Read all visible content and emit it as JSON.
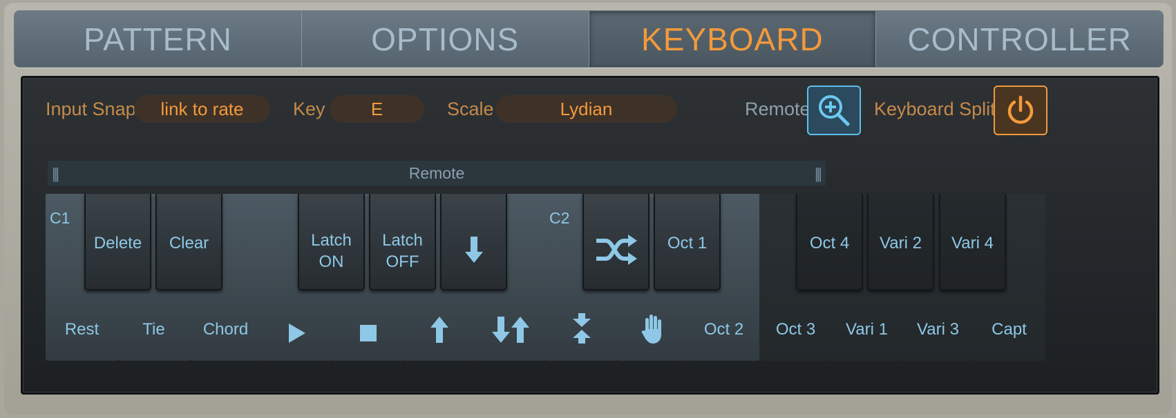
{
  "tabs": [
    {
      "label": "PATTERN"
    },
    {
      "label": "OPTIONS"
    },
    {
      "label": "KEYBOARD"
    },
    {
      "label": "CONTROLLER"
    }
  ],
  "active_tab": "KEYBOARD",
  "controls": {
    "input_snap_label": "Input Snap",
    "input_snap_value": "link to rate",
    "key_label": "Key",
    "key_value": "E",
    "scale_label": "Scale",
    "scale_value": "Lydian",
    "remote_label": "Remote",
    "keyboard_split_label": "Keyboard Split"
  },
  "remote_bar": {
    "label": "Remote"
  },
  "notes": {
    "c1": "C1",
    "c2": "C2"
  },
  "white_keys": [
    {
      "label": "Rest"
    },
    {
      "label": "Tie"
    },
    {
      "label": "Chord"
    },
    {
      "icon": "play-icon"
    },
    {
      "icon": "stop-icon"
    },
    {
      "icon": "arrow-up-icon"
    },
    {
      "icon": "arrows-down-up-icon"
    },
    {
      "icon": "arrows-converge-icon"
    },
    {
      "icon": "hand-icon"
    },
    {
      "label": "Oct 2"
    },
    {
      "label": "Oct 3"
    },
    {
      "label": "Vari 1"
    },
    {
      "label": "Vari 3"
    },
    {
      "label": "Capt"
    }
  ],
  "black_keys": [
    {
      "label": "Delete"
    },
    {
      "label": "Clear"
    },
    {
      "line1": "Latch",
      "line2": "ON"
    },
    {
      "line1": "Latch",
      "line2": "OFF"
    },
    {
      "icon": "arrow-down-icon"
    },
    {
      "icon": "shuffle-icon"
    },
    {
      "label": "Oct 1"
    },
    {
      "label": "Oct 4"
    },
    {
      "label": "Vari 2"
    },
    {
      "label": "Vari 4"
    }
  ],
  "colors": {
    "accent_orange": "#f39a3b",
    "accent_blue": "#5fc0ea",
    "key_label_blue": "#8ec8e6"
  }
}
